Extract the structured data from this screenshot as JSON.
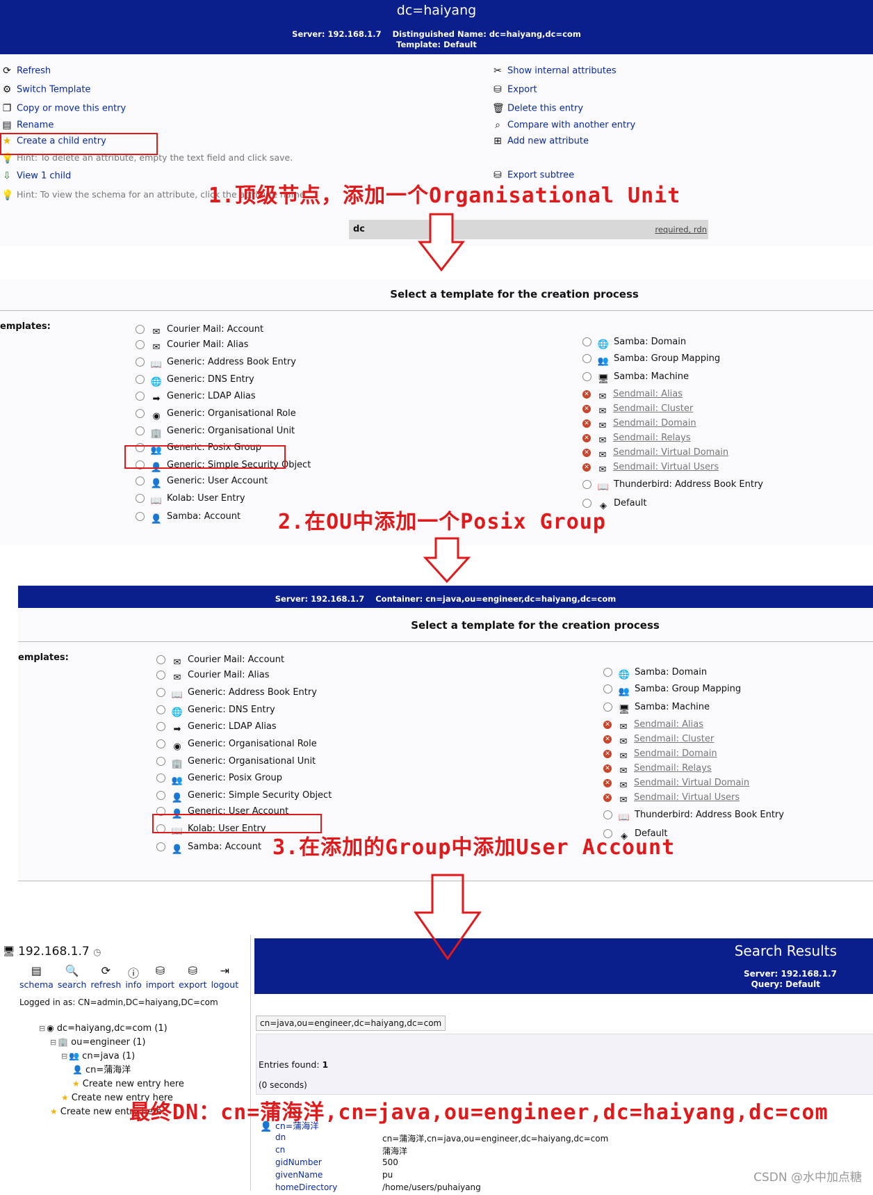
{
  "top": {
    "title": "dc=haiyang",
    "server_label": "Server:",
    "server_value": "192.168.1.7",
    "dn_label": "Distinguished Name:",
    "dn_value": "dc=haiyang,dc=com",
    "template_label": "Template:",
    "template_value": "Default"
  },
  "actions_left": [
    {
      "label": "Refresh",
      "icon": "refresh-icon"
    },
    {
      "label": "Switch Template",
      "icon": "switch-template-icon"
    },
    {
      "label": "Copy or move this entry",
      "icon": "copy-icon"
    },
    {
      "label": "Rename",
      "icon": "rename-icon"
    },
    {
      "label": "Create a child entry",
      "icon": "star-icon"
    }
  ],
  "hint_delete": "Hint: To delete an attribute, empty the text field and click save.",
  "view_child": "View 1 child",
  "hint_schema": "Hint: To view the schema for an attribute, click the attribute name.",
  "actions_right": [
    {
      "label": "Show internal attributes",
      "icon": "tools-icon"
    },
    {
      "label": "Export",
      "icon": "export-icon"
    },
    {
      "label": "Delete this entry",
      "icon": "trash-icon"
    },
    {
      "label": "Compare with another entry",
      "icon": "compare-icon"
    },
    {
      "label": "Add new attribute",
      "icon": "add-attribute-icon"
    }
  ],
  "export_subtree": "Export subtree",
  "attr_row": {
    "name": "dc",
    "flags": "required, rdn"
  },
  "annotations": {
    "step1": "1.顶级节点，添加一个Organisational Unit",
    "step2": "2.在OU中添加一个Posix Group",
    "step3": "3.在添加的Group中添加User Account",
    "final": "最终DN：cn=蒲海洋,cn=java,ou=engineer,dc=haiyang,dc=com"
  },
  "select_template_title": "Select a template for the creation process",
  "templates_label": "emplates:",
  "templates_label2": "emplates:",
  "templates_left": [
    {
      "label": "Courier Mail: Account",
      "icon": "mail-user-icon"
    },
    {
      "label": "Courier Mail: Alias",
      "icon": "mail-alias-icon"
    },
    {
      "label": "Generic: Address Book Entry",
      "icon": "address-book-icon"
    },
    {
      "label": "Generic: DNS Entry",
      "icon": "dns-icon"
    },
    {
      "label": "Generic: LDAP Alias",
      "icon": "arrow-right-icon"
    },
    {
      "label": "Generic: Organisational Role",
      "icon": "globe-icon"
    },
    {
      "label": "Generic: Organisational Unit",
      "icon": "ou-icon"
    },
    {
      "label": "Generic: Posix Group",
      "icon": "group-icon"
    },
    {
      "label": "Generic: Simple Security Object",
      "icon": "user-icon"
    },
    {
      "label": "Generic: User Account",
      "icon": "user-icon"
    },
    {
      "label": "Kolab: User Entry",
      "icon": "address-book-icon"
    },
    {
      "label": "Samba: Account",
      "icon": "user-icon"
    }
  ],
  "templates_right": [
    {
      "label": "Samba: Domain",
      "icon": "dns-icon",
      "disabled": false
    },
    {
      "label": "Samba: Group Mapping",
      "icon": "group-icon",
      "disabled": false
    },
    {
      "label": "Samba: Machine",
      "icon": "computer-icon",
      "disabled": false
    },
    {
      "label": "Sendmail: Alias",
      "icon": "envelope-icon",
      "disabled": true
    },
    {
      "label": "Sendmail: Cluster",
      "icon": "envelope-icon",
      "disabled": true
    },
    {
      "label": "Sendmail: Domain",
      "icon": "envelope-icon",
      "disabled": true
    },
    {
      "label": "Sendmail: Relays",
      "icon": "envelope-icon",
      "disabled": true
    },
    {
      "label": "Sendmail: Virtual Domain",
      "icon": "envelope-icon",
      "disabled": true
    },
    {
      "label": "Sendmail: Virtual Users",
      "icon": "envelope-icon",
      "disabled": true
    },
    {
      "label": "Thunderbird: Address Book Entry",
      "icon": "address-book-icon",
      "disabled": false
    },
    {
      "label": "Default",
      "icon": "default-icon",
      "disabled": false
    }
  ],
  "second": {
    "server_label": "Server:",
    "server_value": "192.168.1.7",
    "container_label": "Container:",
    "container_value": "cn=java,ou=engineer,dc=haiyang,dc=com"
  },
  "bottom": {
    "host": "192.168.1.7",
    "toolbar": [
      "schema",
      "search",
      "refresh",
      "info",
      "import",
      "export",
      "logout"
    ],
    "logged_in": "Logged in as: CN=admin,DC=haiyang,DC=com",
    "tree": [
      {
        "label": "dc=haiyang,dc=com (1)",
        "level": 0,
        "icon": "globe-icon"
      },
      {
        "label": "ou=engineer (1)",
        "level": 1,
        "icon": "ou-icon"
      },
      {
        "label": "cn=java (1)",
        "level": 2,
        "icon": "group-icon"
      },
      {
        "label": "cn=蒲海洋",
        "level": 3,
        "icon": "user-icon"
      },
      {
        "label": "Create new entry here",
        "level": 3,
        "icon": "star-icon"
      },
      {
        "label": "Create new entry here",
        "level": 2,
        "icon": "star-icon"
      },
      {
        "label": "Create new entry here",
        "level": 1,
        "icon": "star-icon"
      }
    ],
    "search_title": "Search Results",
    "search_server": "Server: 192.168.1.7",
    "search_query": "Query: Default",
    "base_dn": "cn=java,ou=engineer,dc=haiyang,dc=com",
    "entries_found_label": "Entries found:",
    "entries_found_value": "1",
    "seconds": "(0 seconds)",
    "result_entry": "cn=蒲海洋",
    "attributes": [
      {
        "k": "dn",
        "v": "cn=蒲海洋,cn=java,ou=engineer,dc=haiyang,dc=com"
      },
      {
        "k": "cn",
        "v": "蒲海洋"
      },
      {
        "k": "gidNumber",
        "v": "500"
      },
      {
        "k": "givenName",
        "v": "pu"
      },
      {
        "k": "homeDirectory",
        "v": "/home/users/puhaiyang"
      }
    ]
  },
  "watermark": "CSDN @水中加点糖"
}
